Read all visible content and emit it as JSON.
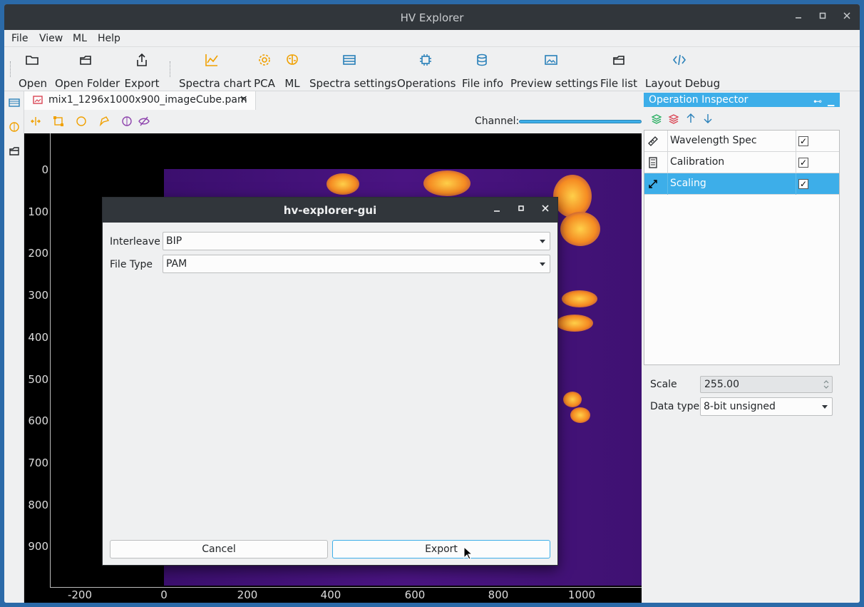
{
  "window": {
    "title": "HV Explorer"
  },
  "menu": [
    "File",
    "View",
    "ML",
    "Help"
  ],
  "toolbar": {
    "open": "Open",
    "open_folder": "Open Folder",
    "export": "Export",
    "spectra_chart": "Spectra chart",
    "pca": "PCA",
    "ml": "ML",
    "spectra_settings": "Spectra settings",
    "operations": "Operations",
    "file_info": "File info",
    "preview_settings": "Preview settings",
    "file_list": "File list",
    "layout_debug": "Layout Debug"
  },
  "tab": {
    "label": "mix1_1296x1000x900_imageCube.pam",
    "close": "×"
  },
  "channel": {
    "label": "Channel:"
  },
  "plot": {
    "y_ticks": [
      "0",
      "100",
      "200",
      "300",
      "400",
      "500",
      "600",
      "700",
      "800",
      "900"
    ],
    "x_ticks": [
      "-200",
      "0",
      "200",
      "400",
      "600",
      "800",
      "1000"
    ]
  },
  "inspector": {
    "title": "Operation Inspector",
    "operations": [
      {
        "name": "Wavelength Spec",
        "checked": "✓",
        "icon": "ruler-icon"
      },
      {
        "name": "Calibration",
        "checked": "✓",
        "icon": "calculator-icon"
      },
      {
        "name": "Scaling",
        "checked": "✓",
        "icon": "resize-icon"
      }
    ],
    "scale_label": "Scale",
    "scale_value": "255.00",
    "dtype_label": "Data type",
    "dtype_value": "8-bit unsigned"
  },
  "dialog": {
    "title": "hv-explorer-gui",
    "interleave_label": "Interleave",
    "interleave_value": "BIP",
    "filetype_label": "File Type",
    "filetype_value": "PAM",
    "cancel": "Cancel",
    "export": "Export"
  },
  "colors": {
    "accent": "#3daee9",
    "titlebar": "#31363b",
    "orange_icon": "#f0a000",
    "blue_icon": "#2980b9"
  }
}
